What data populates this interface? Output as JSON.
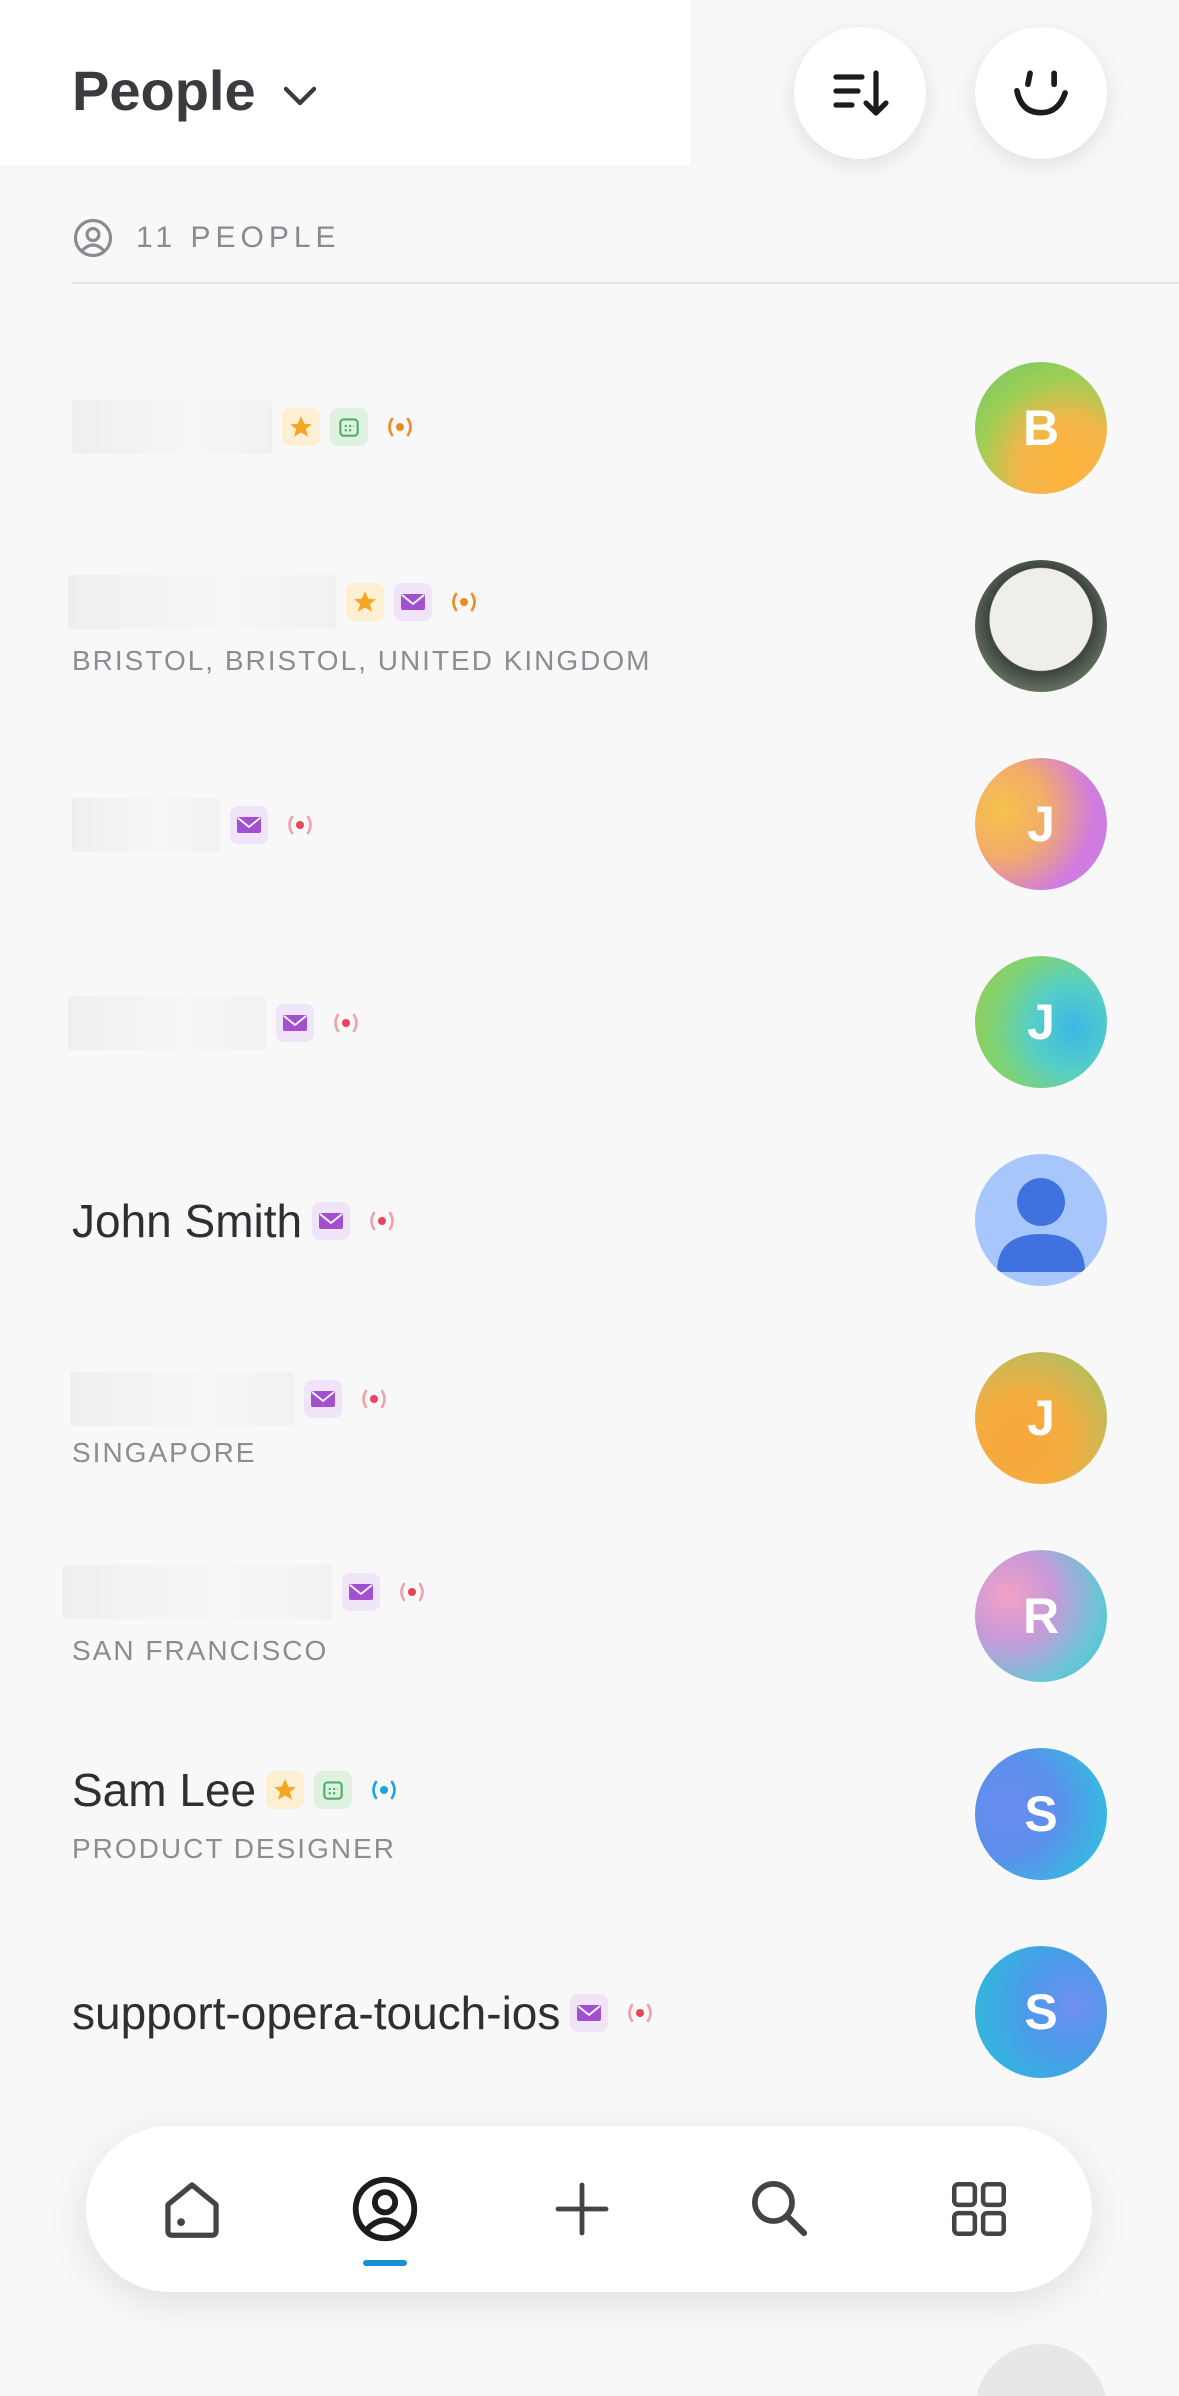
{
  "header": {
    "title": "People",
    "sort_icon": "sort-descending-icon",
    "assistant_icon": "face-icon"
  },
  "summary": {
    "count_label": "11 PEOPLE",
    "icon": "person-circle-icon"
  },
  "people": [
    {
      "name": "",
      "subtitle": "",
      "avatar_letter": "B",
      "badges": [
        "star",
        "calendar",
        "live-orange"
      ]
    },
    {
      "name": "",
      "subtitle": "BRISTOL, BRISTOL, UNITED KINGDOM",
      "avatar_letter": "",
      "badges": [
        "star",
        "mail",
        "live-orange"
      ]
    },
    {
      "name": "",
      "subtitle": "",
      "avatar_letter": "J",
      "badges": [
        "mail",
        "live-red"
      ]
    },
    {
      "name": "",
      "subtitle": "",
      "avatar_letter": "J",
      "badges": [
        "mail",
        "live-red"
      ]
    },
    {
      "name": "John Smith",
      "subtitle": "",
      "avatar_letter": "",
      "badges": [
        "mail",
        "live-red"
      ]
    },
    {
      "name": "",
      "subtitle": "SINGAPORE",
      "avatar_letter": "J",
      "badges": [
        "mail",
        "live-red"
      ]
    },
    {
      "name": "",
      "subtitle": "SAN FRANCISCO",
      "avatar_letter": "R",
      "badges": [
        "mail",
        "live-red"
      ]
    },
    {
      "name": "Sam Lee",
      "subtitle": "PRODUCT DESIGNER",
      "avatar_letter": "S",
      "badges": [
        "star",
        "calendar",
        "live-blue"
      ]
    },
    {
      "name": "support-opera-touch-ios",
      "subtitle": "",
      "avatar_letter": "S",
      "badges": [
        "mail",
        "live-red"
      ]
    }
  ],
  "bottom_nav": {
    "items": [
      "home-icon",
      "people-icon",
      "add-icon",
      "search-icon",
      "apps-grid-icon"
    ],
    "active": "people-icon"
  },
  "colors": {
    "accent": "#1a8fd6",
    "star": "#f6a623",
    "mail": "#a24fd0",
    "live_red": "#e8455a",
    "live_orange": "#f08a24",
    "live_blue": "#1aa5e6"
  }
}
